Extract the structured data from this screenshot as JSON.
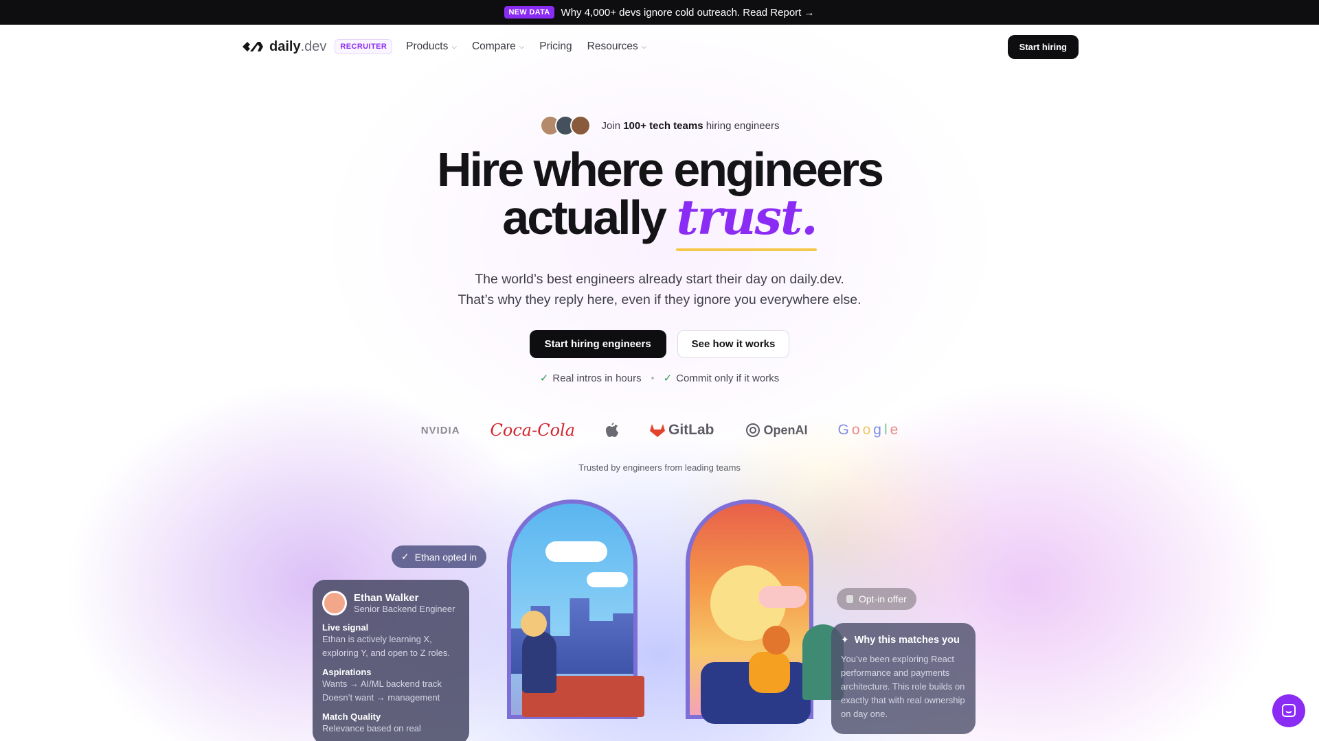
{
  "announcement": {
    "badge": "NEW DATA",
    "text": "Why 4,000+ devs ignore cold outreach. Read Report →"
  },
  "nav": {
    "logo_word": "daily",
    "logo_suffix": ".dev",
    "recruiter_tag": "RECRUITER",
    "items": [
      {
        "label": "Products",
        "has_dropdown": true
      },
      {
        "label": "Compare",
        "has_dropdown": true
      },
      {
        "label": "Pricing",
        "has_dropdown": false
      },
      {
        "label": "Resources",
        "has_dropdown": true
      }
    ],
    "cta": "Start hiring"
  },
  "hero": {
    "join_prefix": "Join",
    "join_bold": "100+ tech teams",
    "join_suffix": "hiring engineers",
    "headline_line1": "Hire where engineers",
    "headline_line2": "actually",
    "headline_accent": "trust.",
    "sub_line1": "The world’s best engineers already start their day on daily.dev.",
    "sub_line2": "That’s why they reply here, even if they ignore you everywhere else.",
    "primary_cta": "Start hiring engineers",
    "secondary_cta": "See how it works",
    "checks": [
      "Real intros in hours",
      "Commit only if it works"
    ],
    "accent_color": "#8b2cf5",
    "underline_color": "#f5c84a"
  },
  "logos": {
    "items": [
      "NVIDIA",
      "Coca-Cola",
      "apple-logo",
      "GitLab",
      "OpenAI",
      "Google"
    ],
    "caption": "Trusted by engineers from leading teams"
  },
  "illustration": {
    "opted_in_pill": "Ethan opted in",
    "offer_pill": "Opt-in offer",
    "candidate": {
      "name": "Ethan Walker",
      "role": "Senior Backend Engineer",
      "live_signal_title": "Live signal",
      "live_signal_text": "Ethan is actively learning X, exploring Y, and open to Z roles.",
      "aspirations_title": "Aspirations",
      "aspirations_wants": "Wants → AI/ML backend track",
      "aspirations_doesnt": "Doesn’t want → management",
      "match_title": "Match Quality",
      "match_text": "Relevance based on real"
    },
    "match_card": {
      "title": "Why this matches you",
      "text": "You’ve been exploring React performance and payments architecture. This role builds on exactly that with real ownership on day one."
    }
  },
  "chat": {
    "icon": "chat-icon"
  }
}
